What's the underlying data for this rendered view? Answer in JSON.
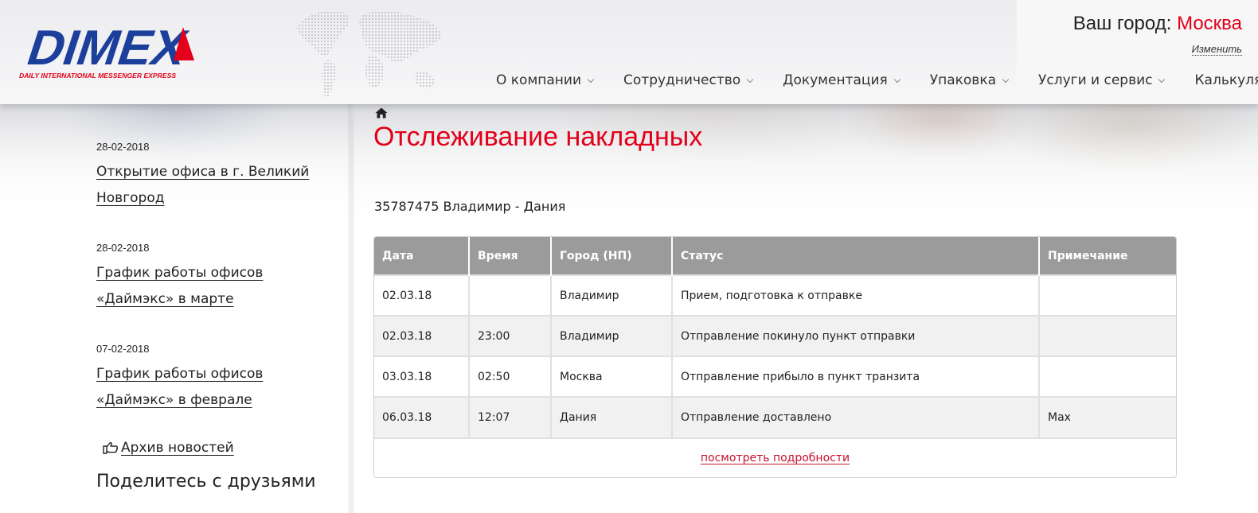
{
  "header": {
    "logo_text": "DIMEX",
    "logo_tagline": "DAILY INTERNATIONAL MESSENGER EXPRESS",
    "city_label": "Ваш город:",
    "city_name": "Москва",
    "change_label": "Изменить",
    "nav": [
      {
        "label": "О компании",
        "has_dropdown": true
      },
      {
        "label": "Сотрудничество",
        "has_dropdown": true
      },
      {
        "label": "Документация",
        "has_dropdown": true
      },
      {
        "label": "Упаковка",
        "has_dropdown": true
      },
      {
        "label": "Услуги и сервис",
        "has_dropdown": true
      },
      {
        "label": "Калькулятор",
        "has_dropdown": false
      }
    ]
  },
  "sidebar": {
    "news": [
      {
        "date": "28-02-2018",
        "title": "Открытие офиса в г. Великий Новгород"
      },
      {
        "date": "28-02-2018",
        "title": "График работы офисов «Даймэкс» в марте"
      },
      {
        "date": "07-02-2018",
        "title": "График работы офисов «Даймэкс» в феврале"
      }
    ],
    "archive_label": "Архив новостей",
    "share_title": "Поделитесь с друзьями"
  },
  "main": {
    "breadcrumb_icon": "home-icon",
    "title": "Отслеживание накладных",
    "waybill": "35787475 Владимир - Дания",
    "table": {
      "headers": [
        "Дата",
        "Время",
        "Город (НП)",
        "Статус",
        "Примечание"
      ],
      "rows": [
        [
          "02.03.18",
          "",
          "Владимир",
          "Прием, подготовка к отправке",
          ""
        ],
        [
          "02.03.18",
          "23:00",
          "Владимир",
          "Отправление покинуло пункт отправки",
          ""
        ],
        [
          "03.03.18",
          "02:50",
          "Москва",
          "Отправление прибыло в пункт транзита",
          ""
        ],
        [
          "06.03.18",
          "12:07",
          "Дания",
          "Отправление доставлено",
          "Max"
        ]
      ]
    },
    "details_link": "посмотреть подробности"
  },
  "colors": {
    "accent_red": "#e2001a",
    "logo_blue": "#1b3f9b",
    "table_header": "#9b9b9b"
  }
}
